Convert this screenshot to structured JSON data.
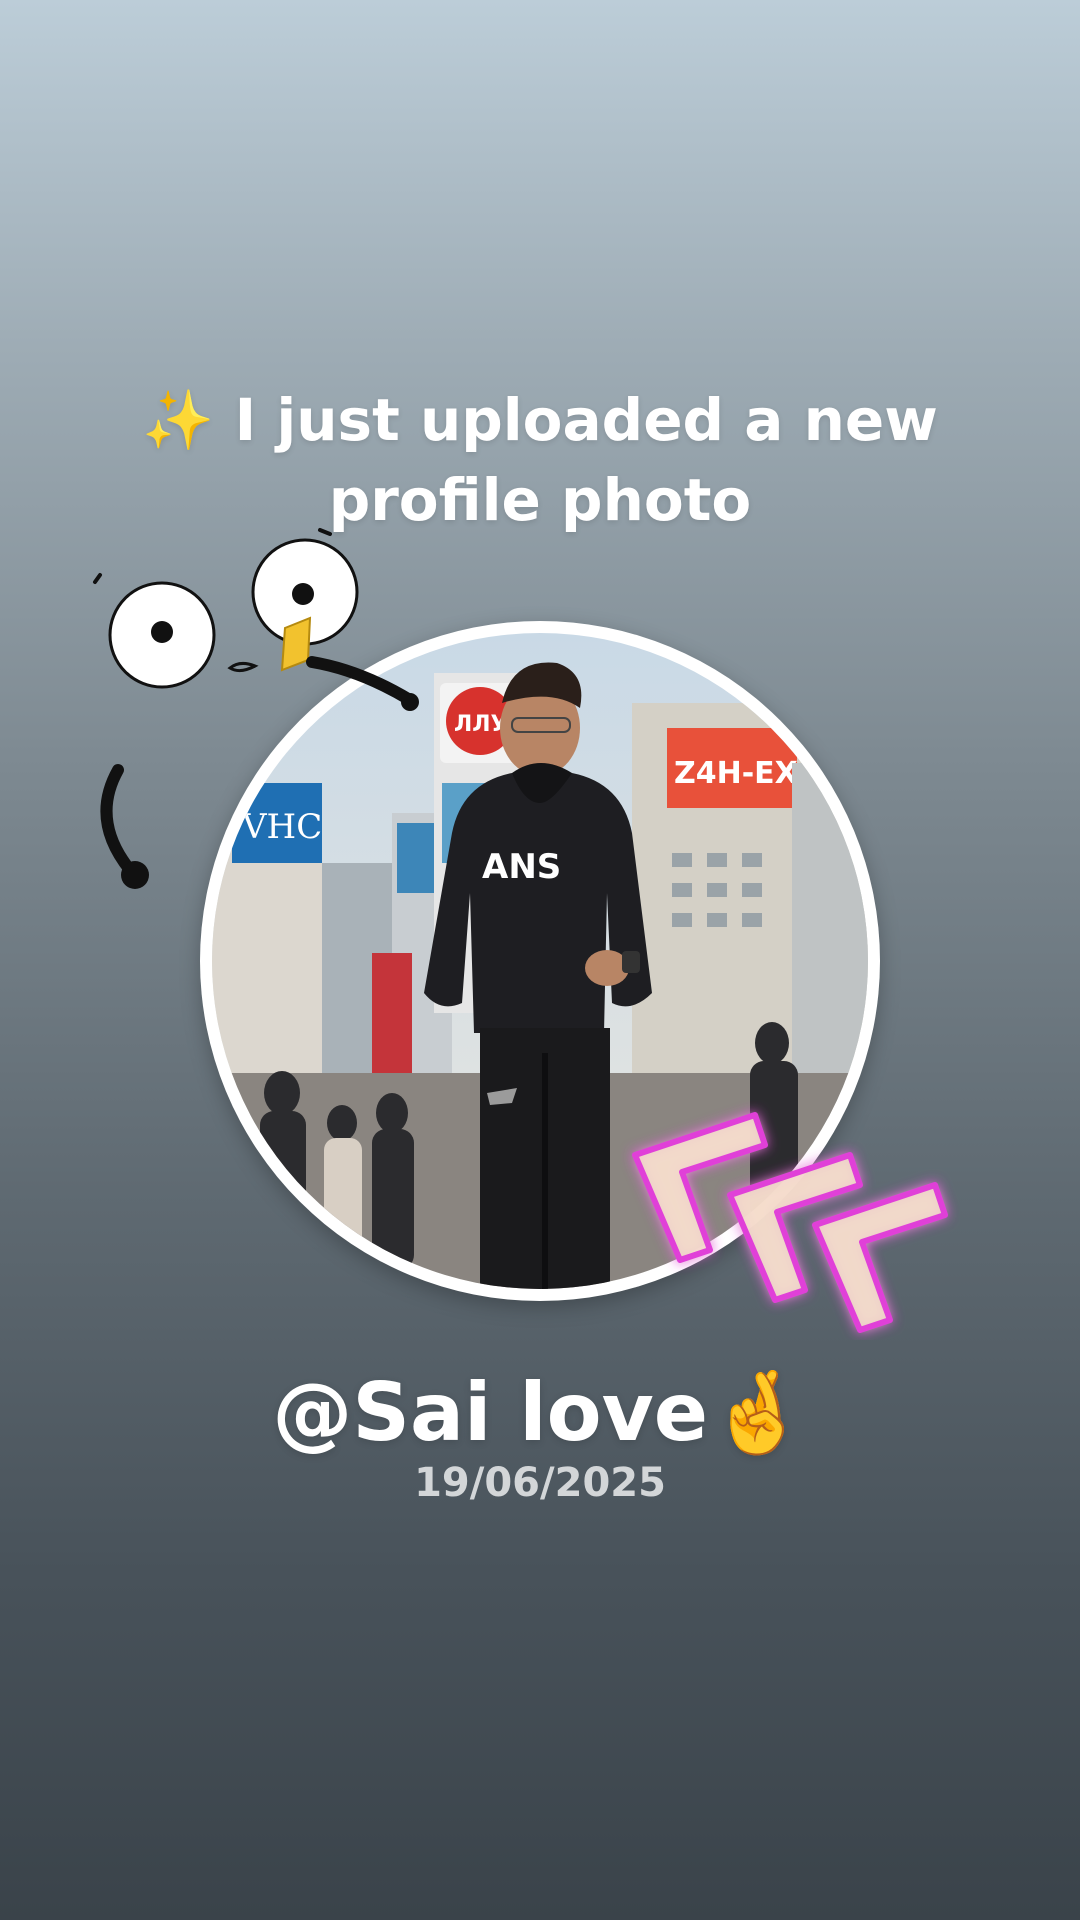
{
  "story": {
    "headline": "✨ I just uploaded a new profile photo",
    "username": "@Sai love🤞",
    "date": "19/06/2025"
  },
  "photo": {
    "signs": [
      "ЛЛУ",
      "Z4H-EX",
      "VHC",
      "ANS"
    ]
  },
  "colors": {
    "background_top": "#bccdd8",
    "background_bottom": "#3a434a",
    "text": "#ffffff",
    "date_text": "#d3d6d8",
    "frame": "#ffffff",
    "neon": "#e040d8"
  },
  "icons": {
    "sparkles": "sparkles-icon",
    "fingers_crossed": "fingers-crossed-icon",
    "face_doodle": "cartoon-face-sticker",
    "arrows": "neon-chevron-arrows-sticker"
  }
}
